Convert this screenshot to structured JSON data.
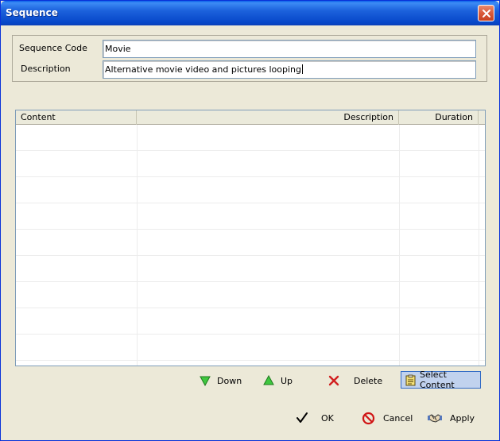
{
  "window": {
    "title": "Sequence",
    "close_icon": "close-icon"
  },
  "form": {
    "sequence_code_label": "Sequence Code",
    "sequence_code_value": "Movie",
    "description_label": "Description",
    "description_value": "Alternative movie video and pictures looping"
  },
  "table": {
    "columns": [
      {
        "label": "Content",
        "align": "left"
      },
      {
        "label": "Description",
        "align": "right"
      },
      {
        "label": "Duration",
        "align": "right"
      }
    ],
    "rows": []
  },
  "list_actions": {
    "down_label": "Down",
    "up_label": "Up",
    "delete_label": "Delete",
    "select_content_label": "Select Content"
  },
  "dialog_actions": {
    "ok_label": "OK",
    "cancel_label": "Cancel",
    "apply_label": "Apply"
  },
  "colors": {
    "titlebar": "#0a5fe8",
    "dialog_bg": "#ece9d8",
    "down_arrow": "#3fc73f",
    "up_arrow": "#3fc73f",
    "delete_x": "#d11f1f",
    "cancel_red": "#d01414"
  }
}
